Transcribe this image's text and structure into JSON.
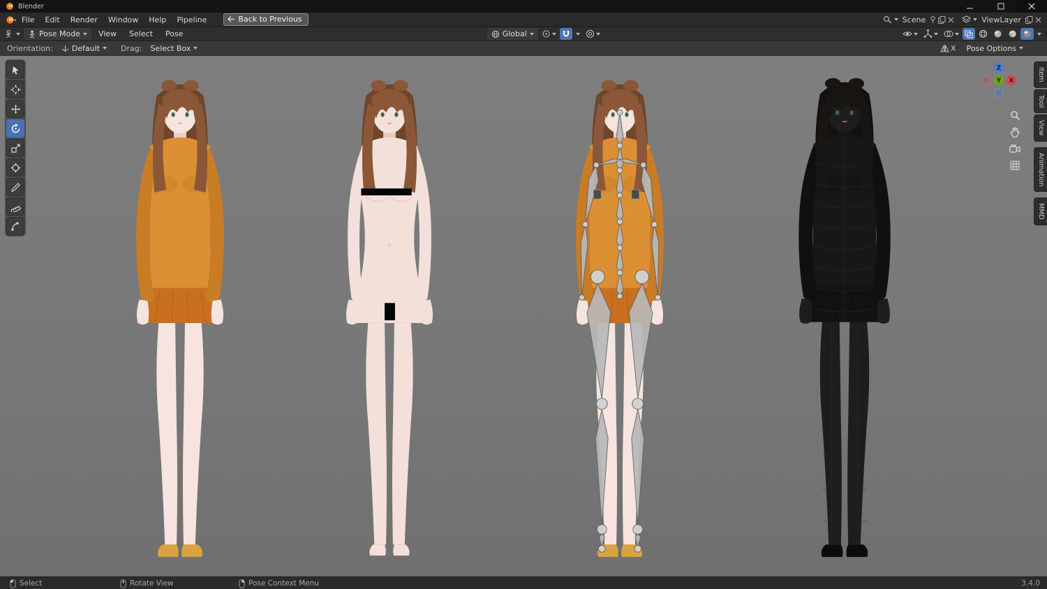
{
  "window": {
    "title": "Blender"
  },
  "topbar": {
    "menus": [
      "File",
      "Edit",
      "Render",
      "Window",
      "Help",
      "Pipeline"
    ],
    "back_button": "Back to Previous",
    "scene_selector": {
      "value": "Scene"
    },
    "viewlayer_selector": {
      "value": "ViewLayer"
    }
  },
  "viewport_header": {
    "mode": "Pose Mode",
    "menus": [
      "View",
      "Select",
      "Pose"
    ],
    "orientation": "Global"
  },
  "tool_settings": {
    "orientation_label": "Orientation:",
    "orientation_value": "Default",
    "drag_label": "Drag:",
    "drag_value": "Select Box",
    "mirror_x_label": "X",
    "pose_options_label": "Pose Options"
  },
  "axis_gizmo": {
    "x": "X",
    "y": "Y",
    "z": "Z"
  },
  "sidebar_tabs": [
    {
      "label": "Item"
    },
    {
      "label": "Tool"
    },
    {
      "label": "View"
    },
    {
      "label": "Animation"
    },
    {
      "label": "MMD"
    }
  ],
  "status_bar": {
    "select": "Select",
    "rotate_view": "Rotate View",
    "pose_context_menu": "Pose Context Menu",
    "version": "3.4.0"
  },
  "colors": {
    "accent_blue": "#4772b3",
    "viewport_background": "#797979",
    "header_background": "#2e2e2e",
    "censor_black": "#050505"
  },
  "viewport": {
    "figures": [
      {
        "name": "clothed-model",
        "variant": "clothed",
        "colors": {
          "hairBack": "#6f452c",
          "hair": "#8a5838",
          "skin": "#f5e4df",
          "skinShade": "#eccfc6",
          "top": "#dd8f33",
          "topShade": "#c87c26",
          "skirt": "#c8701f",
          "skirtShade": "#9e5512",
          "shoes": "#d9a43f"
        }
      },
      {
        "name": "nude-model",
        "variant": "nude",
        "censor_bars": true,
        "colors": {
          "hairBack": "#6f452c",
          "hair": "#8a5838",
          "skin": "#f3e0da",
          "skinShade": "#e6c8bd",
          "censor": "#050505"
        }
      },
      {
        "name": "armature-model",
        "variant": "armature",
        "colors": {
          "hairBack": "#6f452c",
          "hair": "#8a5838",
          "skin": "#f5e4df",
          "skinShade": "#eccfc6",
          "top": "#dd8f33",
          "topShade": "#c87c26",
          "skirt": "#c8701f",
          "skirtShade": "#9e5512",
          "shoes": "#d9a43f",
          "bone": "#b9b9b9",
          "joint": "#d2d2d2",
          "boneStroke": "#636363"
        }
      },
      {
        "name": "wireframe-model",
        "variant": "wireframe",
        "colors": {
          "hairBack": "#131110",
          "hair": "#181513",
          "skin": "#1d1d1d",
          "skinShade": "#161616",
          "top": "#171717",
          "topShade": "#101010",
          "skirt": "#121212",
          "skirtShade": "#0a0a0a",
          "shoes": "#0c0c0c",
          "wire": "#2c2c2c"
        }
      }
    ]
  }
}
